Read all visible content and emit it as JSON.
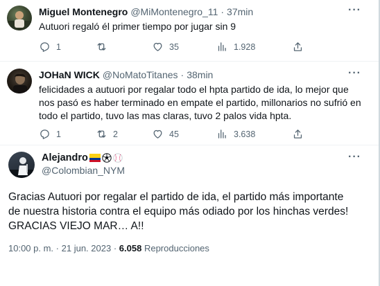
{
  "tweets": [
    {
      "display_name": "Miguel Montenegro",
      "handle": "@MiMontenegro_11",
      "time": "37min",
      "text": "Autuori regaló él primer tiempo por jugar sin 9",
      "replies": "1",
      "retweets": "",
      "likes": "35",
      "views": "1.928"
    },
    {
      "display_name": "JOHaN WICK",
      "handle": "@NoMatoTitanes",
      "time": "38min",
      "text_lines": [
        "felicidades a autuori por regalar todo el hpta partido de ida, lo mejor que",
        "nos pasó es haber terminado en empate el partido, millonarios no sufrió en",
        "todo el partido, tuvo las mas claras, tuvo 2 palos vida hpta."
      ],
      "replies": "1",
      "retweets": "2",
      "likes": "45",
      "views": "3.638"
    }
  ],
  "main_tweet": {
    "display_name": "Alejandro",
    "handle": "@Colombian_NYM",
    "text_lines": [
      "Gracias Autuori por regalar el partido de ida, el partido más importante",
      "de nuestra historia contra el equipo más odiado por los hinchas verdes!",
      "GRACIAS VIEJO MAR… A!!"
    ],
    "time": "10:00 p. m.",
    "date": "21 jun. 2023",
    "views_count": "6.058",
    "views_label": "Reproducciones"
  },
  "icons": {
    "reply": "reply-icon",
    "retweet": "retweet-icon",
    "like": "heart-icon",
    "views": "views-chart-icon",
    "share": "share-icon",
    "more": "more-icon"
  },
  "colors": {
    "text": "#0f1419",
    "secondary": "#536471",
    "divider": "#eff3f4"
  }
}
